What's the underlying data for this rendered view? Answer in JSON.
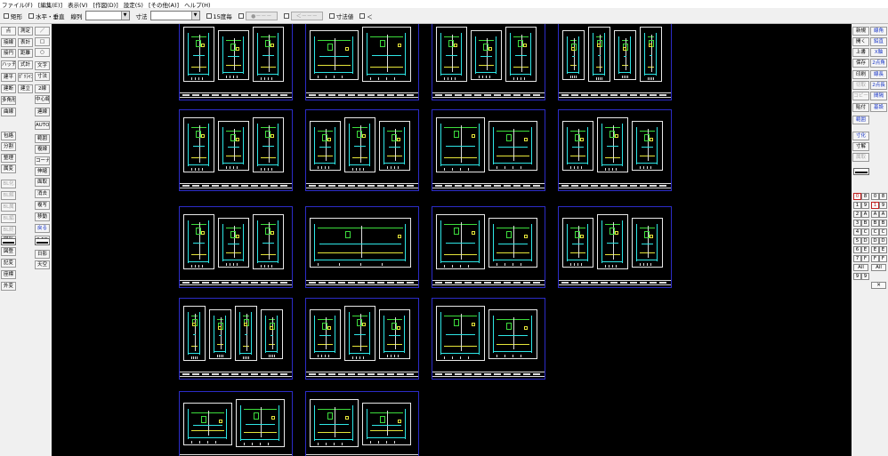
{
  "menu": [
    "ファイル(F)",
    "[編集(E)]",
    "表示(V)",
    "[作図(D)]",
    "設定(S)",
    "[その他(A)]",
    "ヘルプ(H)"
  ],
  "toolbar": {
    "rect_label": "矩形",
    "hv_label": "水平・垂直",
    "linetype_label": "線列",
    "linetype_value": "",
    "dimension_label": "寸法",
    "dimension_value": "",
    "angle15_label": "15度毎",
    "disabled_btn1": "●－－－",
    "disabled_btn2": "＜－－－",
    "dimval_label": "寸法値",
    "less_label": "＜"
  },
  "left_tools": [
    "点",
    "測定",
    "接線",
    "表計",
    "接円",
    "距離",
    "ハッチ",
    "式計",
    "建平",
    "ﾎﾟﾘﾗｲﾝ",
    "建断",
    "建立",
    "多角形",
    "曲線",
    "包絡",
    "分割",
    "整理",
    "属変",
    "BL化",
    "BL解",
    "BL属",
    "BL編",
    "BL終",
    "図形",
    "図登",
    "記変",
    "座標",
    "外変",
    "／",
    "□",
    "○",
    "文字",
    "寸法",
    "2線",
    "中心線",
    "連線",
    "AUTO",
    "範囲",
    "複線",
    "コーナー",
    "伸縮",
    "面取",
    "消去",
    "複写",
    "移動",
    "戻る",
    "2.5D",
    "日影",
    "天空"
  ],
  "right_tools": [
    "新規",
    "開く",
    "上書",
    "保存",
    "印刷",
    "切取",
    "コピー",
    "貼付",
    "範囲",
    "線角",
    "鉛直",
    "X軸",
    "2点角",
    "線長",
    "2点長",
    "間隔",
    "基設",
    "寸化",
    "寸解",
    "属取"
  ],
  "layers": {
    "left": [
      "0",
      "1",
      "2",
      "3",
      "4",
      "5",
      "6",
      "7",
      "All",
      "9"
    ],
    "right": [
      "8",
      "9",
      "A",
      "B",
      "C",
      "D",
      "E",
      "F",
      "All"
    ],
    "left_labels": [
      "8",
      "9",
      "A",
      "B",
      "C",
      "D",
      "E",
      "F",
      "All",
      "9"
    ]
  },
  "colors": {
    "canvas_bg": "#000000",
    "sheet_border": "#2c2cc8",
    "cad_cyan": "#2ee6e6",
    "cad_green": "#3ddc3d",
    "cad_yellow": "#e6e63a"
  }
}
